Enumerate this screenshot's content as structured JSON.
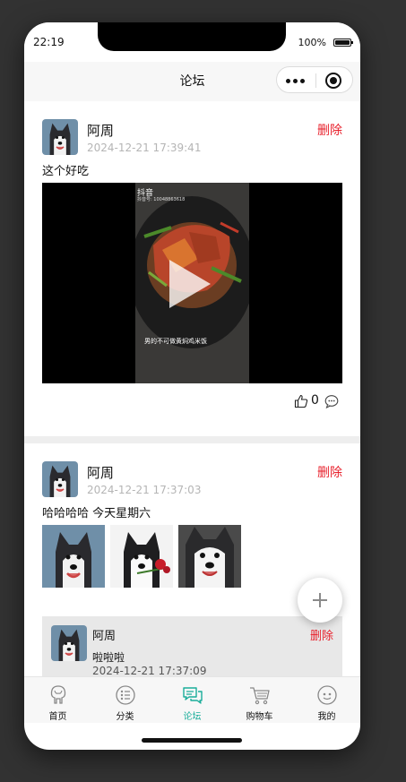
{
  "status_bar": {
    "time": "22:19",
    "battery": "100%"
  },
  "nav": {
    "title": "论坛"
  },
  "posts": [
    {
      "author": "阿周",
      "time": "2024-12-21 17:39:41",
      "delete_label": "删除",
      "text": "这个好吃",
      "video": {
        "watermark": "抖音",
        "watermark_sub": "抖音号: 10048863618",
        "caption": "男的不可做黄焖鸡米饭"
      },
      "like_count": "0"
    },
    {
      "author": "阿周",
      "time": "2024-12-21 17:37:03",
      "delete_label": "删除",
      "text": "哈哈哈哈 今天星期六",
      "image_count": 3,
      "comment": {
        "author": "阿周",
        "text": "啦啦啦",
        "time": "2024-12-21 17:37:09",
        "delete_label": "删除"
      }
    }
  ],
  "tabs": [
    {
      "label": "首页",
      "icon": "home-icon"
    },
    {
      "label": "分类",
      "icon": "category-icon"
    },
    {
      "label": "论坛",
      "icon": "forum-icon",
      "active": true
    },
    {
      "label": "购物车",
      "icon": "cart-icon"
    },
    {
      "label": "我的",
      "icon": "profile-icon"
    }
  ],
  "colors": {
    "accent": "#1aad9a",
    "delete": "#e8222d",
    "muted": "#b5b5b5"
  }
}
